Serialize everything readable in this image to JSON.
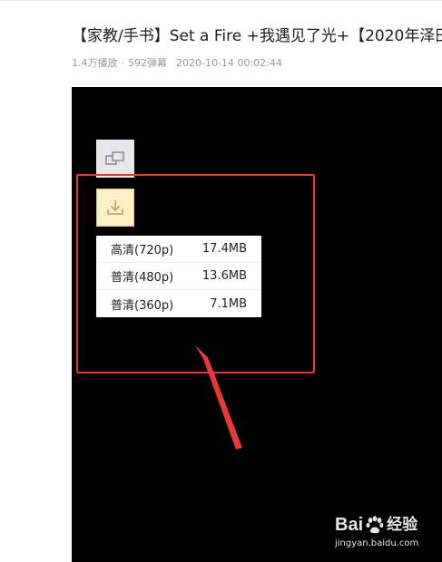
{
  "video": {
    "title": "【家教/手书】Set a Fire +我遇见了光+【2020年泽田",
    "views": "1.4万播放",
    "separator": "·",
    "danmaku": "592弹幕",
    "date": "2020-10-14 00:02:44"
  },
  "player": {
    "buttons": [
      {
        "icon": "picture-in-picture-icon"
      },
      {
        "icon": "download-icon"
      }
    ],
    "quality_options": [
      {
        "label": "高清(720p)",
        "size": "17.4MB"
      },
      {
        "label": "普清(480p)",
        "size": "13.6MB"
      },
      {
        "label": "普清(360p)",
        "size": "7.1MB"
      }
    ]
  },
  "annotation": {
    "box_color": "#e53935",
    "arrow_color": "#e53935"
  },
  "watermark": {
    "brand_text_a": "Bai",
    "brand_text_b": "经验",
    "url": "jingyan.baidu.com"
  },
  "colors": {
    "player_background": "#000000",
    "download_button_bg": "#fdf0c6",
    "menu_bg": "#ffffff"
  }
}
